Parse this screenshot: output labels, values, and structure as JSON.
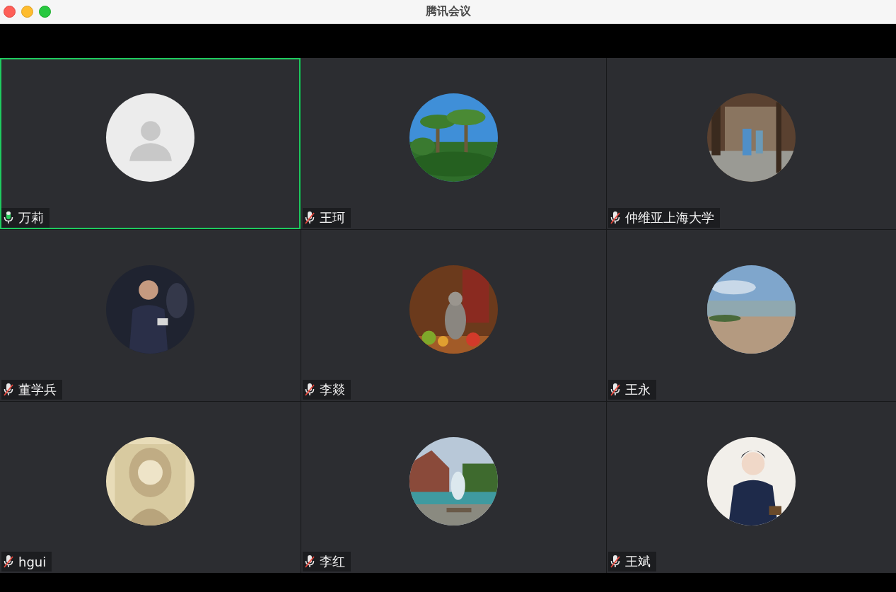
{
  "window": {
    "title": "腾讯会议"
  },
  "participants": [
    {
      "name": "万莉",
      "muted": false,
      "selected": true,
      "avatar": {
        "kind": "default"
      }
    },
    {
      "name": "王珂",
      "muted": true,
      "selected": false
    },
    {
      "name": "仲维亚上海大学",
      "muted": true,
      "selected": false
    },
    {
      "name": "董学兵",
      "muted": true,
      "selected": false
    },
    {
      "name": "李燚",
      "muted": true,
      "selected": false
    },
    {
      "name": "王永",
      "muted": true,
      "selected": false
    },
    {
      "name": "hgui",
      "muted": true,
      "selected": false
    },
    {
      "name": "李红",
      "muted": true,
      "selected": false
    },
    {
      "name": "王斌",
      "muted": true,
      "selected": false
    }
  ]
}
